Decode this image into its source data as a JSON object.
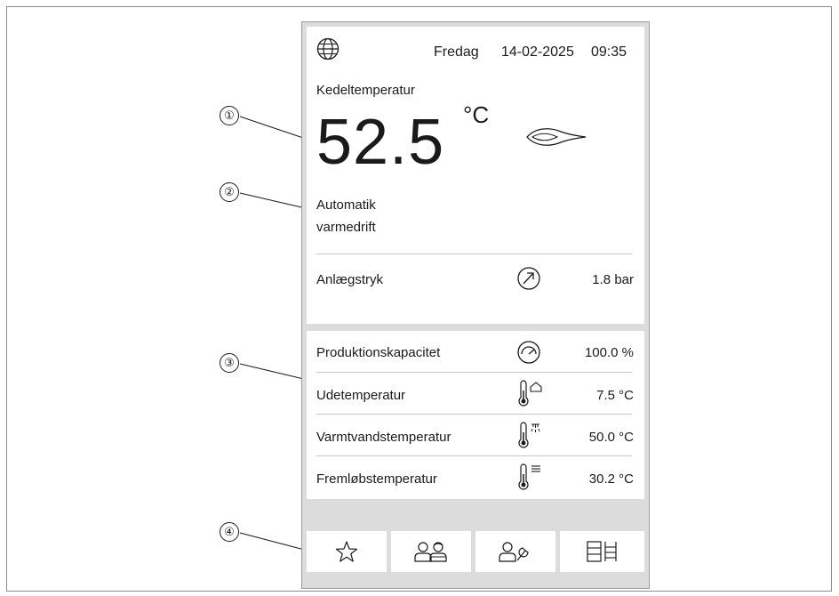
{
  "status_bar": {
    "language_icon": "globe-icon",
    "day": "Fredag",
    "date": "14-02-2025",
    "time": "09:35"
  },
  "boiler": {
    "label": "Kedeltemperatur",
    "value": "52.5",
    "unit": "°C",
    "burner_icon": "flame-icon"
  },
  "mode": {
    "line1": "Automatik",
    "line2": "varmedrift"
  },
  "pressure": {
    "label": "Anlægstryk",
    "icon": "pressure-gauge-icon",
    "value": "1.8 bar"
  },
  "readings": [
    {
      "label": "Produktionskapacitet",
      "icon": "capacity-gauge-icon",
      "value": "100.0 %"
    },
    {
      "label": "Udetemperatur",
      "icon": "outdoor-thermometer-icon",
      "value": "7.5 °C"
    },
    {
      "label": "Varmtvandstemperatur",
      "icon": "hot-water-thermometer-icon",
      "value": "50.0 °C"
    },
    {
      "label": "Fremløbstemperatur",
      "icon": "flow-thermometer-icon",
      "value": "30.2 °C"
    }
  ],
  "nav": [
    {
      "icon": "star-icon"
    },
    {
      "icon": "users-icon"
    },
    {
      "icon": "service-user-icon"
    },
    {
      "icon": "boiler-system-icon"
    }
  ],
  "callouts": [
    "①",
    "②",
    "③",
    "④"
  ],
  "colors": {
    "panel_bg": "#dcdcdc",
    "card_bg": "#ffffff",
    "text": "#1a1a1a",
    "divider": "#c8c8c8"
  }
}
